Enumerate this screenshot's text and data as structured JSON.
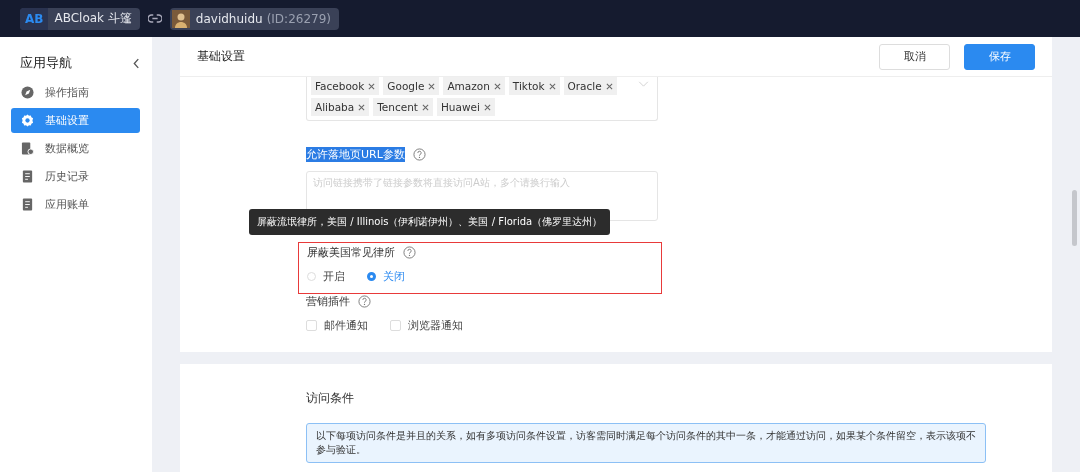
{
  "topbar": {
    "app_badge": "AB",
    "app_name": "ABCloak 斗篷",
    "user_name": "davidhuidu",
    "user_id": "(ID:26279)"
  },
  "sidebar": {
    "title": "应用导航",
    "items": [
      {
        "label": "操作指南",
        "kind": "compass",
        "selected": false
      },
      {
        "label": "基础设置",
        "kind": "gear",
        "selected": true
      },
      {
        "label": "数据概览",
        "kind": "report",
        "selected": false
      },
      {
        "label": "历史记录",
        "kind": "doc",
        "selected": false
      },
      {
        "label": "应用账单",
        "kind": "doc",
        "selected": false
      }
    ]
  },
  "header": {
    "title": "基础设置",
    "cancel": "取消",
    "save": "保存"
  },
  "tags": [
    "Facebook",
    "Google",
    "Amazon",
    "Tiktok",
    "Oracle",
    "Alibaba",
    "Tencent",
    "Huawei"
  ],
  "url_params": {
    "label": "允许落地页URL参数",
    "text_selected": true,
    "placeholder": "访问链接携带了链接参数将直接访问A站，多个请换行输入"
  },
  "law_firm": {
    "label": "屏蔽美国常见律所",
    "highlighted": true,
    "tooltip": "屏蔽流氓律所，美国 / Illinois（伊利诺伊州）、美国 / Florida（佛罗里达州）",
    "options": [
      {
        "label": "开启",
        "selected": false
      },
      {
        "label": "关闭",
        "selected": true
      }
    ]
  },
  "plugins": {
    "label": "营销插件",
    "options": [
      {
        "label": "邮件通知",
        "checked": false
      },
      {
        "label": "浏览器通知",
        "checked": false
      }
    ]
  },
  "conditions": {
    "title": "访问条件",
    "notice": "以下每项访问条件是并且的关系，如有多项访问条件设置，访客需同时满足每个访问条件的其中一条，才能通过访问，如果某个条件留空，表示该项不参与验证。"
  }
}
